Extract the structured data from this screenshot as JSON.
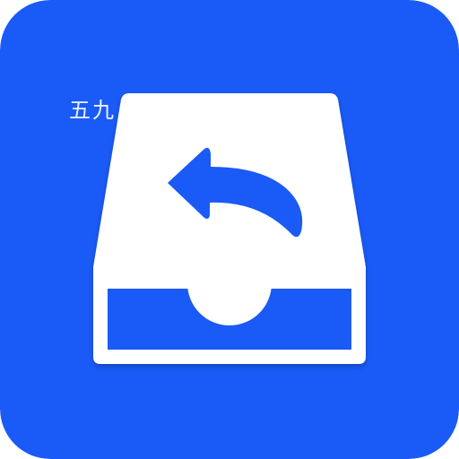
{
  "icon": {
    "name": "inbox-return-icon",
    "background_color": "#1A5AF6",
    "foreground_color": "#FFFFFF"
  },
  "watermark": {
    "text": "五九"
  }
}
